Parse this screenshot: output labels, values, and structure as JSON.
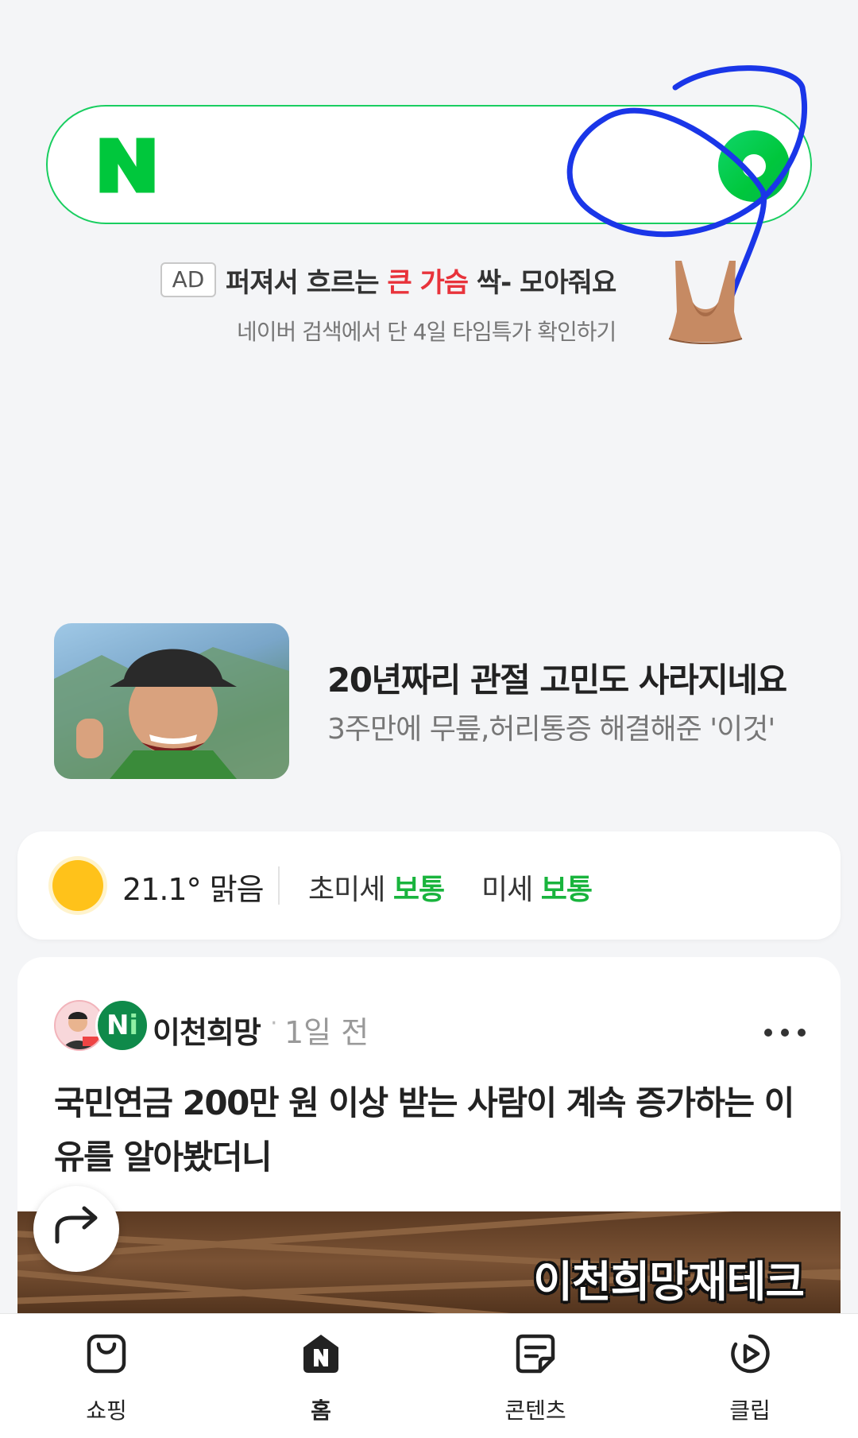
{
  "search": {
    "logo_letter": "N",
    "accent_color": "#19ce60"
  },
  "ad": {
    "badge": "AD",
    "headline_pre": "퍼져서 흐르는 ",
    "headline_highlight": "큰 가슴",
    "headline_post": " 싹- 모아줘요",
    "subline": "네이버 검색에서 단 4일 타임특가 확인하기",
    "highlight_color": "#e8333b"
  },
  "banner": {
    "title": "20년짜리 관절 고민도 사라지네요",
    "subtitle": "3주만에 무릎,허리통증 해결해준 '이것'"
  },
  "weather": {
    "icon": "sun-icon",
    "temp_text": "21.1° 맑음",
    "fine_dust_label": "초미세",
    "fine_dust_level": "보통",
    "dust_label": "미세",
    "dust_level": "보통",
    "level_color": "#19b43d"
  },
  "feed": {
    "author": "이천희망",
    "badge_letter": "N",
    "badge_letter_i": "i",
    "separator": "·",
    "time": "1일 전",
    "title": "국민연금 200만 원 이상 받는 사람이 계속 증가하는 이유를 알아봤더니",
    "image_caption": "이천희망재테크"
  },
  "bottom_nav": {
    "items": [
      {
        "label": "쇼핑",
        "icon": "shopping-bag-icon"
      },
      {
        "label": "홈",
        "icon": "home-n-icon",
        "active": true
      },
      {
        "label": "콘텐츠",
        "icon": "content-icon"
      },
      {
        "label": "클립",
        "icon": "clip-play-icon"
      }
    ]
  }
}
